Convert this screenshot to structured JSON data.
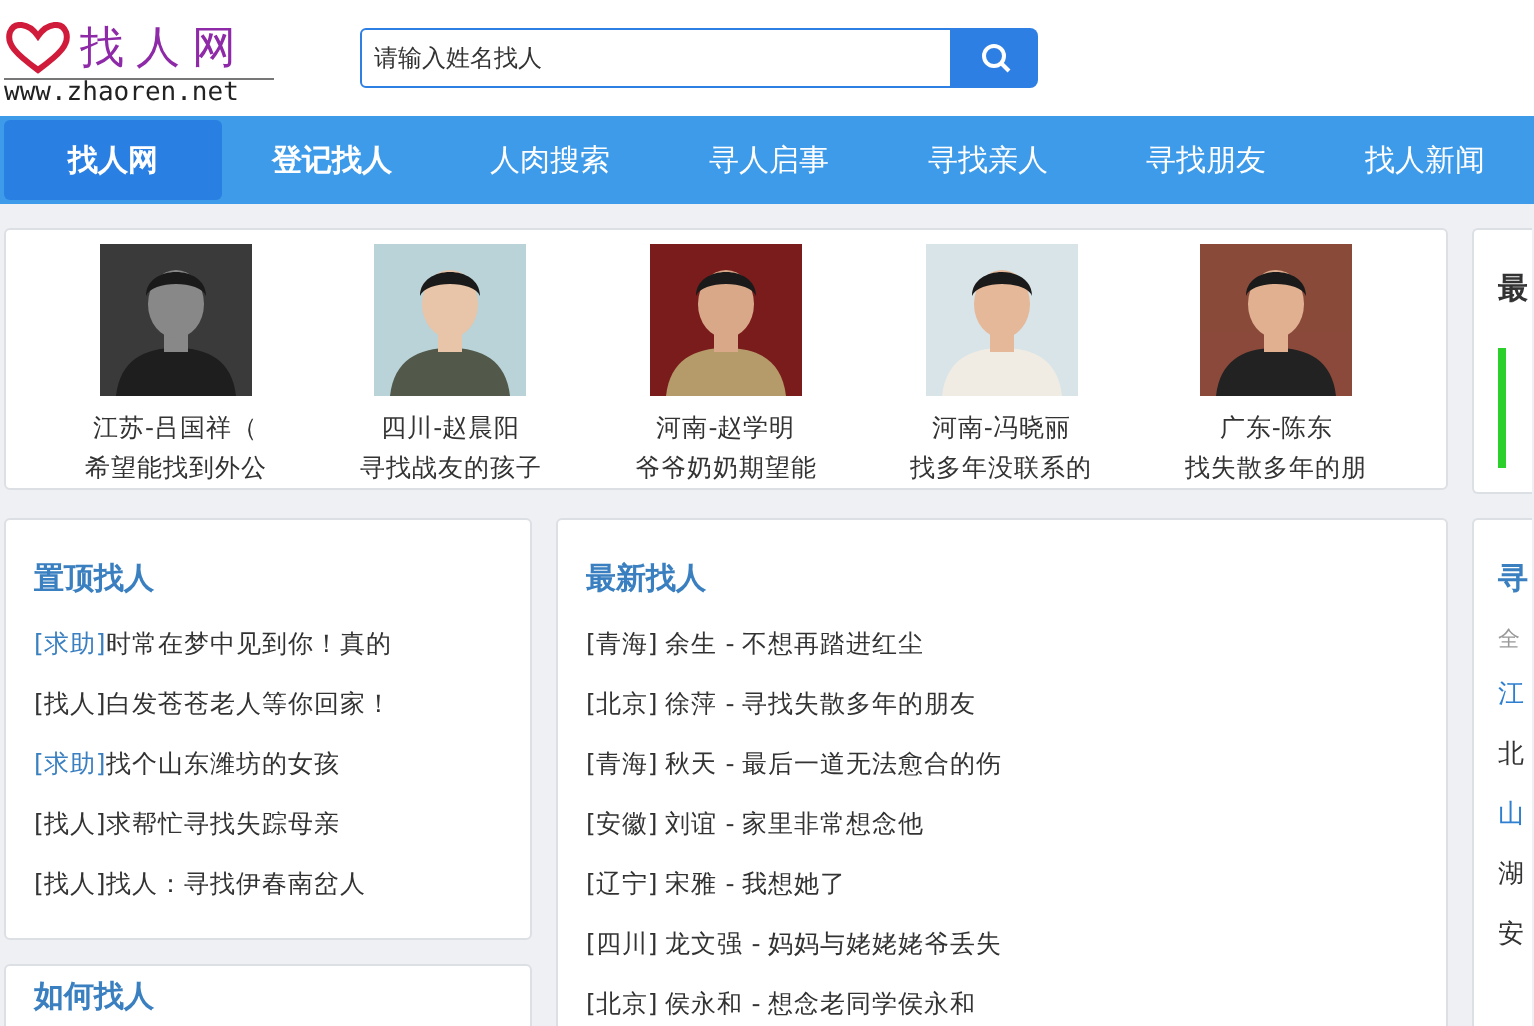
{
  "header": {
    "logo_title": "找人网",
    "logo_url": "www.zhaoren.net",
    "search": {
      "placeholder": "请输入姓名找人"
    }
  },
  "nav": [
    {
      "label": "找人网",
      "selected": true
    },
    {
      "label": "登记找人",
      "selected": false
    },
    {
      "label": "人肉搜索",
      "selected": false
    },
    {
      "label": "寻人启事",
      "selected": false
    },
    {
      "label": "寻找亲人",
      "selected": false
    },
    {
      "label": "寻找朋友",
      "selected": false
    },
    {
      "label": "找人新闻",
      "selected": false
    }
  ],
  "featured": [
    {
      "kind": "picture",
      "name": "江苏-吕国祥（",
      "note": "希望能找到外公"
    },
    {
      "kind": "picture",
      "name": "四川-赵晨阳",
      "note": "寻找战友的孩子"
    },
    {
      "kind": "picture",
      "name": "河南-赵学明",
      "note": "爷爷奶奶期望能"
    },
    {
      "kind": "picture",
      "name": "河南-冯晓丽",
      "note": "找多年没联系的"
    },
    {
      "kind": "picture",
      "name": "广东-陈东",
      "note": "找失散多年的朋"
    }
  ],
  "side_top": {
    "title": "最"
  },
  "pinned": {
    "title": "置顶找人",
    "items": [
      {
        "tag": "[求助]",
        "text": "时常在梦中见到你！真的",
        "highlighted": true
      },
      {
        "tag": "[找人]",
        "text": "白发苍苍老人等你回家！",
        "highlighted": false
      },
      {
        "tag": "[求助]",
        "text": "找个山东潍坊的女孩",
        "highlighted": true
      },
      {
        "tag": "[找人]",
        "text": "求帮忙寻找失踪母亲",
        "highlighted": false
      },
      {
        "tag": "[找人]",
        "text": "找人：寻找伊春南岔人",
        "highlighted": false
      }
    ]
  },
  "how_to": {
    "title": "如何找人"
  },
  "latest": {
    "title": "最新找人",
    "items": [
      "[青海] 余生 - 不想再踏进红尘",
      "[北京] 徐萍 - 寻找失散多年的朋友",
      "[青海] 秋天 - 最后一道无法愈合的伤",
      "[安徽] 刘谊 - 家里非常想念他",
      "[辽宁] 宋雅 - 我想她了",
      "[四川] 龙文强 - 妈妈与姥姥姥爷丢失",
      "[北京] 侯永和 - 想念老同学侯永和"
    ]
  },
  "regions": {
    "title": "寻",
    "items": [
      {
        "label": "全",
        "kind": "caption"
      },
      {
        "label": "江",
        "kind": "link",
        "highlighted": true
      },
      {
        "label": "北",
        "kind": "link",
        "highlighted": false
      },
      {
        "label": "山",
        "kind": "link",
        "highlighted": true
      },
      {
        "label": "湖",
        "kind": "link",
        "highlighted": false
      },
      {
        "label": "安",
        "kind": "link",
        "highlighted": false
      }
    ]
  }
}
